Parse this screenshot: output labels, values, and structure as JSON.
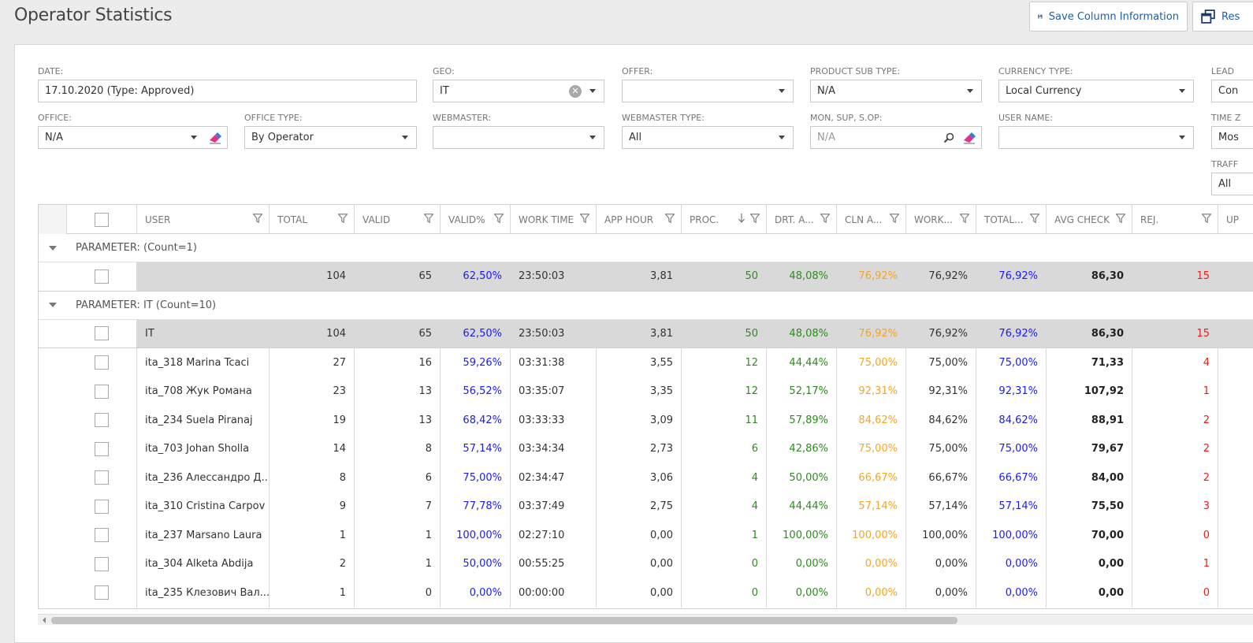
{
  "title": "Operator Statistics",
  "toolbar": {
    "save_label": "Save Column Information",
    "reset_label": "Res"
  },
  "filters": {
    "date": {
      "label": "DATE:",
      "value": "17.10.2020 (Type: Approved)"
    },
    "geo": {
      "label": "GEO:",
      "value": "IT"
    },
    "offer": {
      "label": "OFFER:",
      "value": ""
    },
    "product_sub_type": {
      "label": "PRODUCT SUB TYPE:",
      "value": "N/A"
    },
    "currency_type": {
      "label": "CURRENCY TYPE:",
      "value": "Local Currency"
    },
    "lead": {
      "label": "LEAD",
      "value": "Con"
    },
    "office": {
      "label": "OFFICE:",
      "value": "N/A"
    },
    "office_type": {
      "label": "OFFICE TYPE:",
      "value": "By Operator"
    },
    "webmaster": {
      "label": "WEBMASTER:",
      "value": ""
    },
    "webmaster_type": {
      "label": "WEBMASTER TYPE:",
      "value": "All"
    },
    "mon_sup": {
      "label": "MON, SUP, S.OP:",
      "placeholder": "N/A"
    },
    "user_name": {
      "label": "USER NAME:",
      "value": ""
    },
    "time": {
      "label": "TIME Z",
      "value": "Mos"
    },
    "traffic": {
      "label": "TRAFF",
      "value": "All"
    }
  },
  "columns": [
    "USER",
    "TOTAL",
    "VALID",
    "VALID%",
    "WORK TIME",
    "APP HOUR",
    "PROC.",
    "DRT. A...",
    "CLN A...",
    "WORK...",
    "TOTAL...",
    "AVG CHECK",
    "REJ.",
    "UP"
  ],
  "groups": [
    {
      "label": "PARAMETER: (Count=1)",
      "summary": {
        "user": "",
        "total": "104",
        "valid": "65",
        "valid_pct": "62,50%",
        "work_time": "23:50:03",
        "app_hour": "3,81",
        "proc": "50",
        "drt": "48,08%",
        "cln": "76,92%",
        "work": "76,92%",
        "total_pct": "76,92%",
        "avg_check": "86,30",
        "rej": "15"
      }
    },
    {
      "label": "PARAMETER: IT (Count=10)",
      "summary": {
        "user": "IT",
        "total": "104",
        "valid": "65",
        "valid_pct": "62,50%",
        "work_time": "23:50:03",
        "app_hour": "3,81",
        "proc": "50",
        "drt": "48,08%",
        "cln": "76,92%",
        "work": "76,92%",
        "total_pct": "76,92%",
        "avg_check": "86,30",
        "rej": "15"
      },
      "rows": [
        {
          "user": "ita_318 Marina Tcaci",
          "total": "27",
          "valid": "16",
          "valid_pct": "59,26%",
          "work_time": "03:31:38",
          "app_hour": "3,55",
          "proc": "12",
          "drt": "44,44%",
          "cln": "75,00%",
          "work": "75,00%",
          "total_pct": "75,00%",
          "avg_check": "71,33",
          "rej": "4"
        },
        {
          "user": "ita_708 Жук Романа",
          "total": "23",
          "valid": "13",
          "valid_pct": "56,52%",
          "work_time": "03:35:07",
          "app_hour": "3,35",
          "proc": "12",
          "drt": "52,17%",
          "cln": "92,31%",
          "work": "92,31%",
          "total_pct": "92,31%",
          "avg_check": "107,92",
          "rej": "1"
        },
        {
          "user": "ita_234 Suela Piranaj",
          "total": "19",
          "valid": "13",
          "valid_pct": "68,42%",
          "work_time": "03:33:33",
          "app_hour": "3,09",
          "proc": "11",
          "drt": "57,89%",
          "cln": "84,62%",
          "work": "84,62%",
          "total_pct": "84,62%",
          "avg_check": "88,91",
          "rej": "2"
        },
        {
          "user": "ita_703 Johan Sholla",
          "total": "14",
          "valid": "8",
          "valid_pct": "57,14%",
          "work_time": "03:34:34",
          "app_hour": "2,73",
          "proc": "6",
          "drt": "42,86%",
          "cln": "75,00%",
          "work": "75,00%",
          "total_pct": "75,00%",
          "avg_check": "79,67",
          "rej": "2"
        },
        {
          "user": "ita_236 Алессандро Д...",
          "total": "8",
          "valid": "6",
          "valid_pct": "75,00%",
          "work_time": "02:34:47",
          "app_hour": "3,06",
          "proc": "4",
          "drt": "50,00%",
          "cln": "66,67%",
          "work": "66,67%",
          "total_pct": "66,67%",
          "avg_check": "84,00",
          "rej": "2"
        },
        {
          "user": "ita_310 Cristina Carpov",
          "total": "9",
          "valid": "7",
          "valid_pct": "77,78%",
          "work_time": "03:37:49",
          "app_hour": "2,75",
          "proc": "4",
          "drt": "44,44%",
          "cln": "57,14%",
          "work": "57,14%",
          "total_pct": "57,14%",
          "avg_check": "75,50",
          "rej": "3"
        },
        {
          "user": "ita_237 Marsano Laura",
          "total": "1",
          "valid": "1",
          "valid_pct": "100,00%",
          "work_time": "02:27:10",
          "app_hour": "0,00",
          "proc": "1",
          "drt": "100,00%",
          "cln": "100,00%",
          "work": "100,00%",
          "total_pct": "100,00%",
          "avg_check": "70,00",
          "rej": "0"
        },
        {
          "user": "ita_304 Alketa Abdija",
          "total": "2",
          "valid": "1",
          "valid_pct": "50,00%",
          "work_time": "00:55:25",
          "app_hour": "0,00",
          "proc": "0",
          "drt": "0,00%",
          "cln": "0,00%",
          "work": "0,00%",
          "total_pct": "0,00%",
          "avg_check": "0,00",
          "rej": "1"
        },
        {
          "user": "ita_235 Клезович Вал...",
          "total": "1",
          "valid": "0",
          "valid_pct": "0,00%",
          "work_time": "00:00:00",
          "app_hour": "0,00",
          "proc": "0",
          "drt": "0,00%",
          "cln": "0,00%",
          "work": "0,00%",
          "total_pct": "0,00%",
          "avg_check": "0,00",
          "rej": "0"
        }
      ]
    }
  ],
  "colors": {
    "link": "#1f5ea8",
    "valid_pct": "#1a1aff",
    "proc": "#2e8b1f",
    "cln": "#f5a623",
    "rej": "#e8201a",
    "summary_bg": "#d9d9d9"
  }
}
